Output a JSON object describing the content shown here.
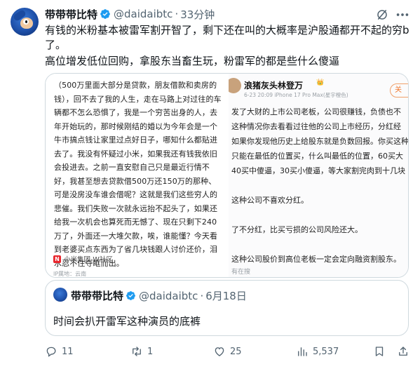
{
  "tweet": {
    "author": {
      "display_name": "带带带比特",
      "handle": "@daidaibtc",
      "separator": "·",
      "time": "33分钟"
    },
    "body": [
      "有钱的米粉基本被雷军割开智了，剩下还在叫的大概率是沪股通都开不起的穷b了。",
      "高位增发低位回购，拿股东当畜生玩，粉雷军的都是些什么傻逼"
    ],
    "media": {
      "left": {
        "lines": [
          "（500万里面大部分是贷款，朋友借款和卖房的钱），回不去了我的人生，走在马路上对过往的车辆都不怎么恐惧了，我是一个穷苦出身的人，去年开始玩的，那时候刚结的婚以为今年会是一个牛市搞点钱让家里过点好日子，哪知什么都贴进去了。我没有怀疑过小米，如果我还有钱我依旧会投进去。之前一直安慰自己只是最近行情不好，我甚至想去贷款借500万还150万的那种、可是没房没车谁会借呢？这就是我们这些穷人的悲催。我们失败一次就永远抬不起头了，如果还给我一次机会也算死而无憾了、现在只剩下240万了，外面还一大堆欠款，唉，谁能懂？今天看到老婆买点东西为了省几块钱跟人讨价还价，泪水忍不住夺眶而出。"
        ],
        "tag": "小米集团-W社区",
        "tag_mark": "N",
        "ip": "IP属地：云南"
      },
      "right": {
        "name": "浪猪灰头林登万",
        "badge": "👑",
        "meta": "6-23 20:09  iPhone 17 Pro Max(星宇橙色)",
        "follow": "关",
        "lines": [
          "发了大财的上市公司老板，公司很赚钱，负债也不",
          "这种情况你去看看过往他的公司上市经历，分红经",
          "如果你发现他历史上给股东就是负数回报。你买这种",
          "只能在最低的位置买，什么叫最低的位置，60买大",
          "40买中傻逼，30买小傻逼，等大家割完肉到十几块",
          "",
          "这种公司不喜欢分红。",
          "",
          "了不分红，比买亏损的公司风险还大。",
          "",
          "这种公司股价到高位老板一定会定向融资割股东。"
        ],
        "reply": "有在搜"
      }
    },
    "quote": {
      "display_name": "带带带比特",
      "handle": "@daidaibtc",
      "separator": "·",
      "date": "6月18日",
      "text": "时间会扒开雷军这种演员的底裤"
    },
    "actions": {
      "replies": "11",
      "retweets": "1",
      "likes": "25",
      "views": "5,537"
    },
    "colors": {
      "verified": "#1d9bf0",
      "muted": "#536471",
      "border": "#cfd9de"
    }
  }
}
